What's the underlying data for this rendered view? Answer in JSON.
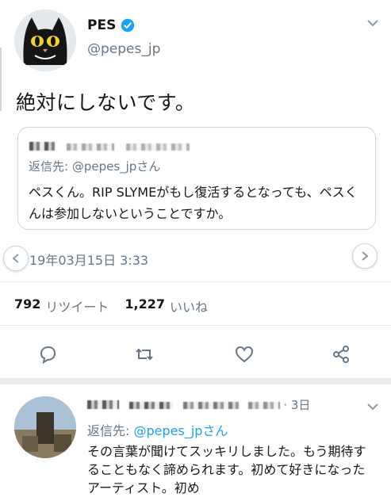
{
  "tweet": {
    "author_name": "PES",
    "author_handle": "@pepes_jp",
    "text": "絶対にしないです。",
    "timestamp": "19年03月15日 3:33",
    "stats": {
      "retweets": "792",
      "retweets_label": "リツイート",
      "likes": "1,227",
      "likes_label": "いいね"
    }
  },
  "quoted_tweet": {
    "reply_to_label": "返信先: @pepes_jpさん",
    "text": "ペスくん。RIP SLYMEがもし復活するとなっても、ペスくんは参加しないということですか。"
  },
  "reply": {
    "age": "· 3日",
    "reply_to_prefix": "返信先: ",
    "reply_to_link": "@pepes_jpさん",
    "text": "その言葉が聞けてスッキリしました。もう期待することもなく諦められます。初めて好きになったアーティスト。初め"
  },
  "icons": [
    "verified-icon",
    "chevron-down-icon",
    "reply-icon",
    "retweet-icon",
    "like-icon",
    "share-icon",
    "chevron-right-icon"
  ],
  "colors": {
    "accent": "#1da1f2",
    "secondary_text": "#657786",
    "border": "#e6ecf0"
  }
}
